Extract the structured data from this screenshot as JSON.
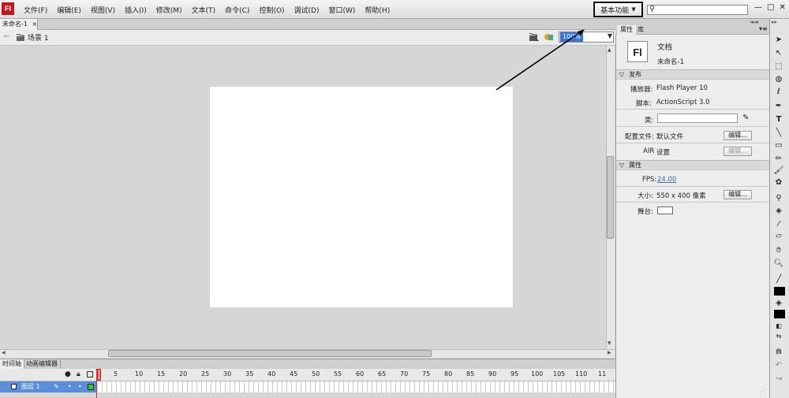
{
  "app": {
    "logo": "Fl"
  },
  "menu": [
    "文件(F)",
    "编辑(E)",
    "视图(V)",
    "插入(I)",
    "修改(M)",
    "文本(T)",
    "命令(C)",
    "控制(O)",
    "调试(D)",
    "窗口(W)",
    "帮助(H)"
  ],
  "workspace": {
    "label": "基本功能",
    "arrow": "▼"
  },
  "search": {
    "icon": "⚲",
    "value": ""
  },
  "window_controls": {
    "minimize": "—",
    "maximize": "□",
    "close": "✕"
  },
  "document": {
    "tab_name": "未命名-1",
    "close": "×",
    "scene": "场景 1",
    "zoom": "100%"
  },
  "timeline": {
    "tabs": [
      "时间轴",
      "动画编辑器"
    ],
    "frame_numbers": [
      "1",
      "5",
      "10",
      "15",
      "20",
      "25",
      "30",
      "35",
      "40",
      "45",
      "50",
      "55",
      "60",
      "65",
      "70",
      "75",
      "80",
      "85",
      "90",
      "95",
      "100",
      "105",
      "110",
      "11"
    ],
    "layer": {
      "name": "图层 1"
    }
  },
  "properties": {
    "tabs": [
      "属性",
      "库"
    ],
    "doc_icon": "Fl",
    "doc_type": "文档",
    "doc_name": "未命名-1",
    "publish": {
      "header": "发布",
      "player_label": "播放器:",
      "player_value": "Flash Player 10",
      "script_label": "脚本:",
      "script_value": "ActionScript 3.0",
      "class_label": "类:",
      "class_value": "",
      "profile_label": "配置文件:",
      "profile_value": "默认文件",
      "edit_label": "编辑...",
      "air_label": "AIR",
      "air_value": "设置",
      "air_edit": "编辑..."
    },
    "props": {
      "header": "属性",
      "fps_label": "FPS:",
      "fps_value": "24.00",
      "size_label": "大小:",
      "size_value": "550 x 400 像素",
      "size_edit": "编辑...",
      "stage_label": "舞台:"
    }
  },
  "colors": {
    "accent": "#3875d7",
    "logo": "#c4161c",
    "layer_highlight": "#5a8ed8",
    "playhead": "#d03030"
  }
}
